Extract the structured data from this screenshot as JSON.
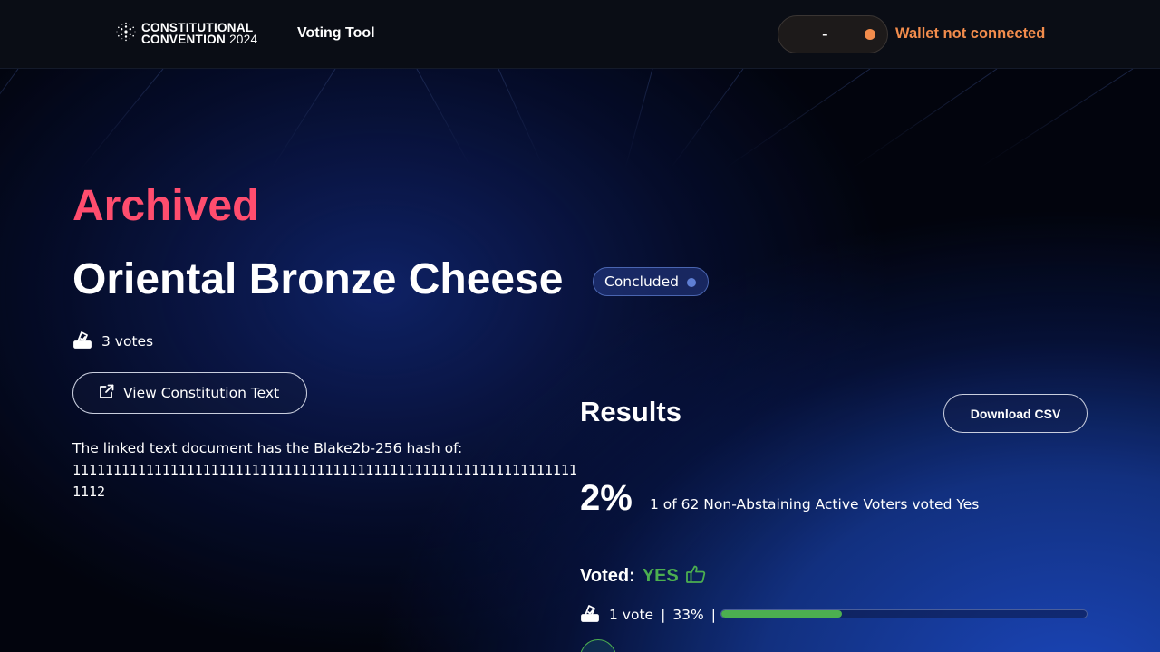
{
  "header": {
    "logo_line1": "CONSTITUTIONAL",
    "logo_line2": "CONVENTION",
    "logo_year": "2024",
    "nav_label": "Voting Tool",
    "wallet_value": "-",
    "wallet_status": "Wallet not connected"
  },
  "proposal": {
    "state": "Archived",
    "title": "Oriental Bronze Cheese",
    "status_badge": "Concluded",
    "votes_label": "3 votes",
    "view_button": "View Constitution Text",
    "hash_intro": "The linked text document has the Blake2b-256 hash of:",
    "hash_value": "111111111111111111111111111111111111111111111111111111111111111112"
  },
  "results": {
    "title": "Results",
    "download_button": "Download CSV",
    "percent": "2%",
    "summary": "1 of 62 Non-Abstaining Active Voters voted Yes",
    "voted_label": "Voted:",
    "voted_value": "YES",
    "vote_count": "1 vote",
    "vote_share": "33%",
    "separator": "|",
    "bar_fraction": 0.33
  },
  "colors": {
    "archived": "#ff4d6e",
    "yes": "#4caf50",
    "wallet_warn": "#f28c4c",
    "badge_dot": "#5f7fd4"
  },
  "icons": {
    "logo": "cardano-logo-icon",
    "votes": "ballot-box-icon",
    "view": "external-link-icon",
    "voted": "thumbs-up-icon"
  }
}
